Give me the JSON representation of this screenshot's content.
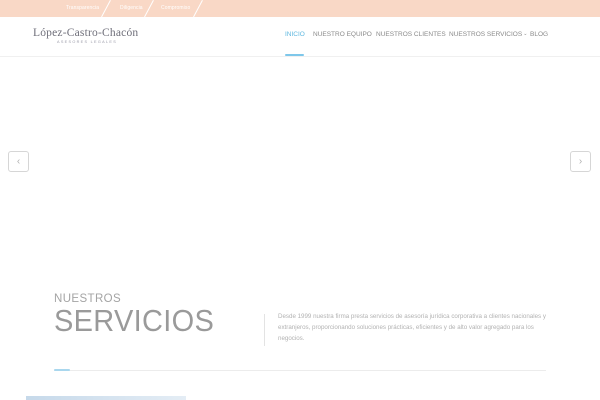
{
  "topbar": {
    "tags": [
      "Transparencia",
      "Diligencia",
      "Compromiso"
    ],
    "background": "#f9d8c6"
  },
  "header": {
    "logo": {
      "name": "López-Castro-Chacón",
      "subtitle": "ASESORES LEGALES"
    },
    "nav": [
      {
        "label": "INICIO",
        "active": true
      },
      {
        "label": "NUESTRO EQUIPO",
        "active": false
      },
      {
        "label": "NUESTROS CLIENTES",
        "active": false
      },
      {
        "label": "NUESTROS SERVICIOS",
        "active": false,
        "dropdown": true
      },
      {
        "label": "BLOG",
        "active": false
      }
    ],
    "accent": "#5fb8e0"
  },
  "slider": {
    "prev_icon": "chevron-left-icon",
    "next_icon": "chevron-right-icon"
  },
  "services": {
    "kicker": "NUESTROS",
    "title": "SERVICIOS",
    "description": "Desde 1999 nuestra firma presta servicios de asesoría jurídica corporativa a clientes nacionales y extranjeros, proporcionando soluciones prácticas, eficientes y de alto valor agregado para los negocios."
  }
}
